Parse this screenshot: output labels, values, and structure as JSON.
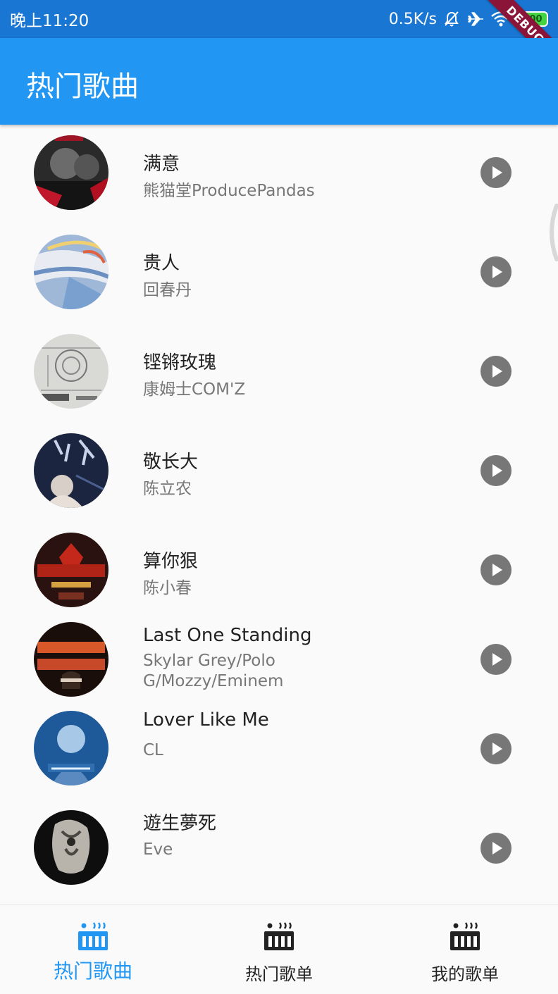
{
  "status_bar": {
    "time": "晚上11:20",
    "speed": "0.5K/s",
    "battery": "100",
    "icons": [
      "bell-off-icon",
      "airplane-icon",
      "wifi-icon",
      "battery-icon"
    ]
  },
  "debug_banner": "DEBUG",
  "app_bar": {
    "title": "热门歌曲"
  },
  "songs": [
    {
      "title": "满意",
      "artist": "熊猫堂ProducePandas"
    },
    {
      "title": "贵人",
      "artist": "回春丹"
    },
    {
      "title": "铿锵玫瑰",
      "artist": "康姆士COM'Z"
    },
    {
      "title": "敬长大",
      "artist": "陈立农"
    },
    {
      "title": "算你狠",
      "artist": "陈小春"
    },
    {
      "title": "Last One Standing",
      "artist": "Skylar Grey/Polo G/Mozzy/Eminem"
    },
    {
      "title": "Lover Like Me",
      "artist": "CL"
    },
    {
      "title": "遊生夢死",
      "artist": "Eve"
    }
  ],
  "bottom_nav": {
    "items": [
      {
        "label": "热门歌曲",
        "icon": "music-chart-icon",
        "active": true
      },
      {
        "label": "热门歌单",
        "icon": "music-chart-icon",
        "active": false
      },
      {
        "label": "我的歌单",
        "icon": "music-chart-icon",
        "active": false
      }
    ]
  },
  "colors": {
    "status_bar": "#1976d2",
    "app_bar": "#2196f3",
    "active_nav": "#2196f3",
    "play_button": "#777777",
    "debug_banner": "#8a1538"
  }
}
